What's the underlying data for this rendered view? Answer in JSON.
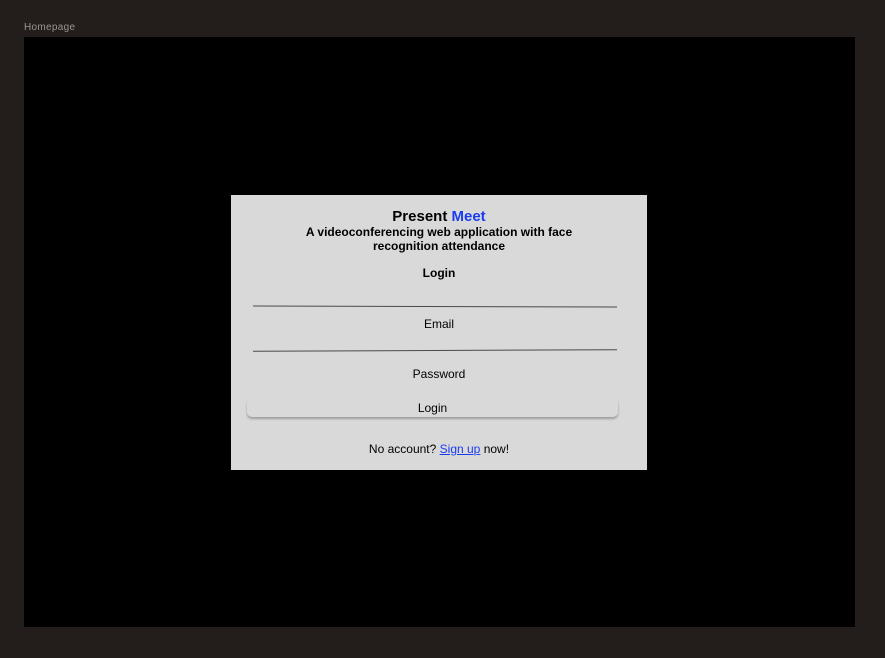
{
  "frame": {
    "label": "Homepage"
  },
  "card": {
    "title_prefix": "Present",
    "title_accent": "Meet",
    "subtitle": "A videoconferencing web application with face recognition attendance",
    "heading": "Login",
    "email_label": "Email",
    "email_value": "",
    "password_label": "Password",
    "password_value": "",
    "login_button": "Login",
    "signup_prefix": "No account?",
    "signup_link": "Sign up",
    "signup_suffix": "now!"
  },
  "colors": {
    "outer_background": "#231d1c",
    "frame_background": "#000000",
    "card_background": "#d9d9d9",
    "accent": "#1a3cf0"
  }
}
